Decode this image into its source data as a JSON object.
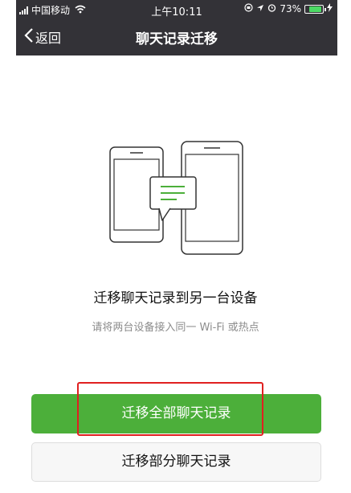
{
  "status_bar": {
    "carrier": "中国移动",
    "time": "上午10:11",
    "battery": "73%",
    "battery_level": 0.73
  },
  "nav": {
    "back_label": "返回",
    "title": "聊天记录迁移"
  },
  "content": {
    "headline": "迁移聊天记录到另一台设备",
    "subline": "请将两台设备接入同一 Wi-Fi 或热点"
  },
  "buttons": {
    "primary": "迁移全部聊天记录",
    "secondary": "迁移部分聊天记录"
  },
  "colors": {
    "nav_bg": "#333237",
    "primary_button": "#4caf3a",
    "highlight": "#e02020"
  }
}
